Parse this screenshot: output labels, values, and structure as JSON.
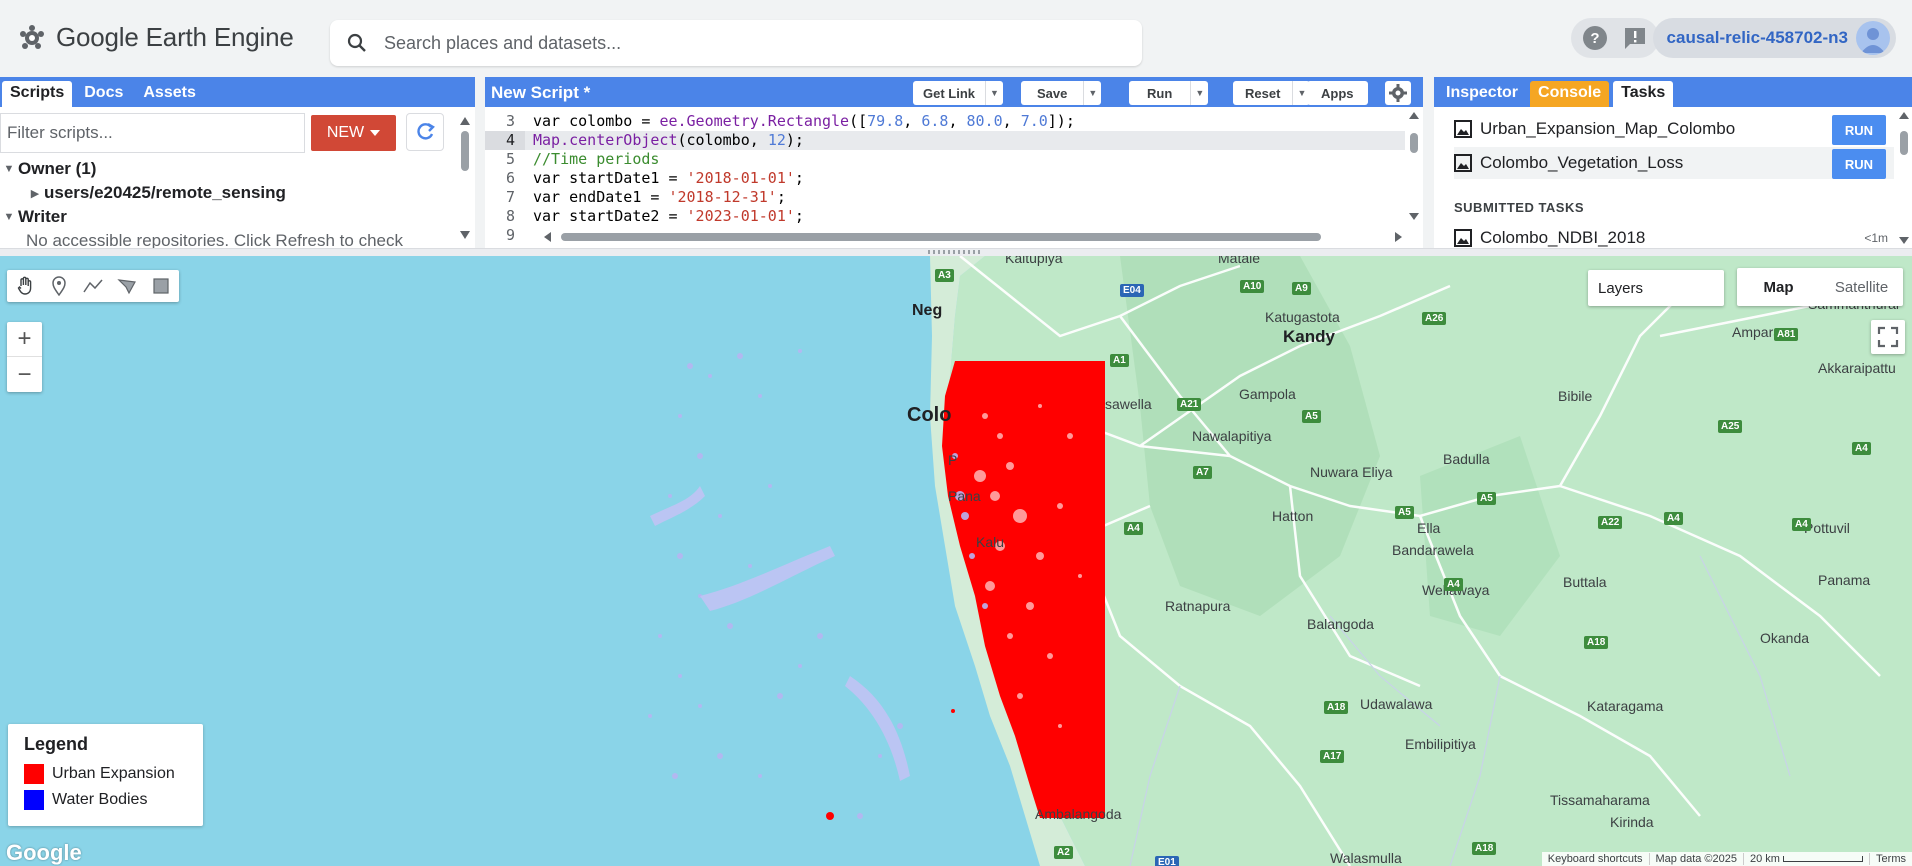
{
  "header": {
    "app_title": "Google Earth Engine",
    "search_placeholder": "Search places and datasets...",
    "help_icon": "help-icon",
    "feedback_icon": "feedback-icon",
    "project": "causal-relic-458702-n3"
  },
  "left_panel": {
    "tabs": [
      "Scripts",
      "Docs",
      "Assets"
    ],
    "active_tab": "Scripts",
    "filter_placeholder": "Filter scripts...",
    "new_label": "NEW",
    "tree": {
      "owner": "Owner (1)",
      "owner_repo": "users/e20425/remote_sensing",
      "writer": "Writer",
      "writer_note": "No accessible repositories. Click Refresh to check"
    }
  },
  "editor": {
    "title": "New Script *",
    "buttons": {
      "get_link": "Get Link",
      "save": "Save",
      "run": "Run",
      "reset": "Reset",
      "apps": "Apps"
    },
    "line_numbers": [
      "3",
      "4",
      "5",
      "6",
      "7",
      "8",
      "9"
    ],
    "lines": {
      "l3": {
        "kw": "var",
        "name": " colombo = ",
        "fn": "ee.Geometry.Rectangle",
        "open": "([",
        "n1": "79.8",
        "c1": ", ",
        "n2": "6.8",
        "c2": ", ",
        "n3": "80.0",
        "c3": ", ",
        "n4": "7.0",
        "close": "]);"
      },
      "l4": {
        "fn": "Map.centerObject",
        "args": "(colombo, ",
        "n": "12",
        "close": ");"
      },
      "l5": {
        "comment": "//Time periods"
      },
      "l6": {
        "kw": "var",
        "name": " startDate1 = ",
        "str": "'2018-01-01'",
        "end": ";"
      },
      "l7": {
        "kw": "var",
        "name": " endDate1 = ",
        "str": "'2018-12-31'",
        "end": ";"
      },
      "l8": {
        "kw": "var",
        "name": " startDate2 = ",
        "str": "'2023-01-01'",
        "end": ";"
      }
    }
  },
  "right_panel": {
    "tabs": [
      "Inspector",
      "Console",
      "Tasks"
    ],
    "active_tab": "Tasks",
    "tasks": [
      {
        "name": "Urban_Expansion_Map_Colombo",
        "action": "RUN"
      },
      {
        "name": "Colombo_Vegetation_Loss",
        "action": "RUN"
      }
    ],
    "submitted_heading": "SUBMITTED TASKS",
    "submitted": [
      {
        "name": "Colombo_NDBI_2018",
        "age": "<1m"
      }
    ]
  },
  "map": {
    "layers_label": "Layers",
    "map_types": [
      "Map",
      "Satellite"
    ],
    "active_map_type": "Map",
    "zoom_in": "+",
    "zoom_out": "−",
    "legend": {
      "title": "Legend",
      "items": [
        {
          "label": "Urban Expansion",
          "color": "#ff0000"
        },
        {
          "label": "Water Bodies",
          "color": "#0000ff"
        }
      ]
    },
    "places": {
      "kandy": "Kandy",
      "katugastota": "Katugastota",
      "kaltupiya": "Kaltupiya",
      "matale": "Matale",
      "gampola": "Gampola",
      "nawalapitiya": "Nawalapitiya",
      "nuwara_eliya": "Nuwara Eliya",
      "badulla": "Badulla",
      "bibile": "Bibile",
      "ampara": "Ampara",
      "akkaraipattu": "Akkaraipattu",
      "sammanthurai": "Sammanthurai",
      "hatton": "Hatton",
      "ella": "Ella",
      "bandarawela": "Bandarawela",
      "wellawaya": "Wellawaya",
      "buttala": "Buttala",
      "pottuvil": "Pottuvil",
      "panama": "Panama",
      "okanda": "Okanda",
      "ratnapura": "Ratnapura",
      "balangoda": "Balangoda",
      "kataragama": "Kataragama",
      "udawalawa": "Udawalawa",
      "embilipitiya": "Embilipitiya",
      "tissamaharama": "Tissamaharama",
      "kirinda": "Kirinda",
      "walasmulla": "Walasmulla",
      "avissawella": "sawella",
      "negombo": "Neg",
      "colombo": "Colo",
      "pa": "P",
      "panadura": "Pana",
      "kalutara": "Kalu",
      "ambalangoda": "Ambalangoda"
    },
    "roads": [
      "A3",
      "E04",
      "A10",
      "A9",
      "A26",
      "A1",
      "A21",
      "A5",
      "A7",
      "A4",
      "A5",
      "A5",
      "A25",
      "A4",
      "A22",
      "A4",
      "A4",
      "A4",
      "A18",
      "A17",
      "A18",
      "A2",
      "E01",
      "A18",
      "A81"
    ],
    "footer": {
      "shortcuts": "Keyboard shortcuts",
      "data": "Map data ©2025",
      "scale": "20 km",
      "terms": "Terms"
    },
    "google_logo": "Google"
  },
  "colors": {
    "accent_blue": "#4b84e8",
    "new_button_red": "#d14836",
    "console_orange": "#f5a623",
    "ocean": "#8ad4e8",
    "land": "#bfe8c8",
    "urban_red": "#ff0000"
  }
}
